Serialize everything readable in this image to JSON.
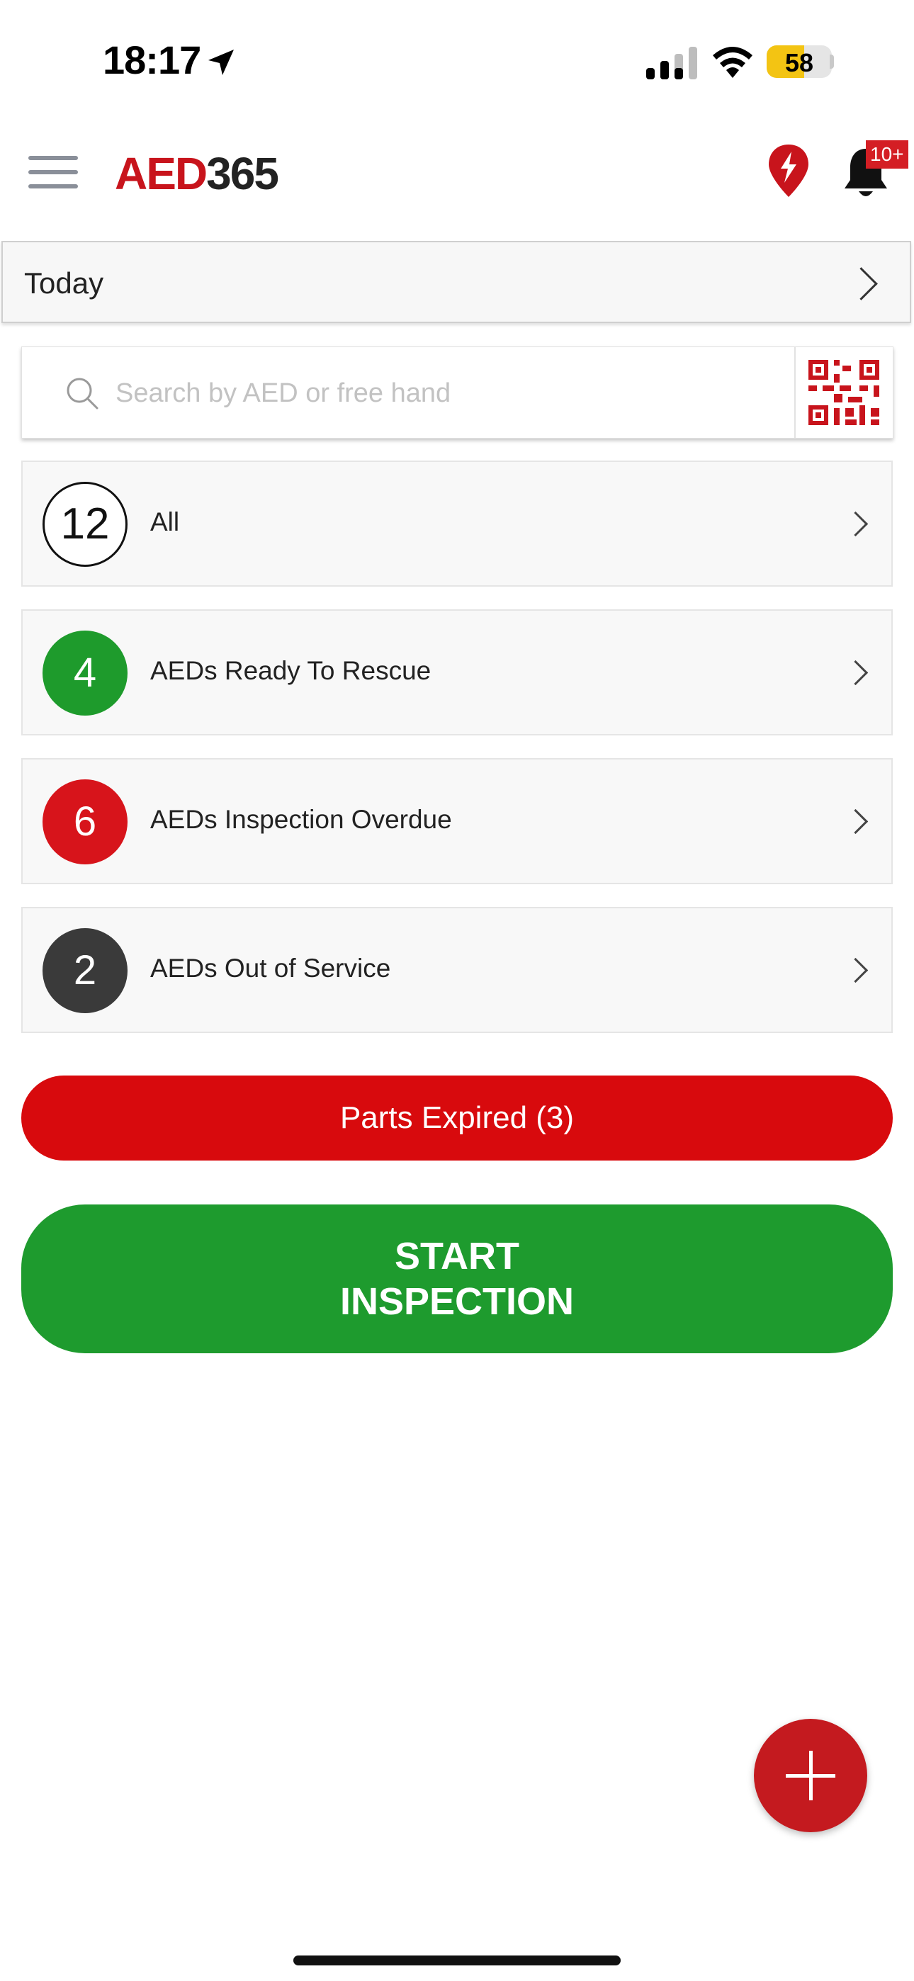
{
  "status_bar": {
    "time": "18:17",
    "battery_percent": "58",
    "battery_level": 0.58,
    "icons": [
      "location-arrow-icon",
      "cellular-signal-icon",
      "wifi-icon",
      "battery-icon"
    ]
  },
  "header": {
    "logo_part1": "AED",
    "logo_part2": "365",
    "notification_badge": "10+",
    "icons": [
      "menu-icon",
      "aed-location-pin-icon",
      "bell-icon"
    ]
  },
  "date_filter": {
    "label": "Today"
  },
  "search": {
    "placeholder": "Search by AED or free hand",
    "value": "",
    "icons": [
      "search-icon",
      "qr-code-icon"
    ]
  },
  "categories": [
    {
      "count": "12",
      "label": "All",
      "style": "outline"
    },
    {
      "count": "4",
      "label": "AEDs Ready To Rescue",
      "style": "green",
      "color": "#1e9b2c"
    },
    {
      "count": "6",
      "label": "AEDs Inspection Overdue",
      "style": "red",
      "color": "#d7141b"
    },
    {
      "count": "2",
      "label": "AEDs Out of Service",
      "style": "dark",
      "color": "#3a3a3a"
    }
  ],
  "parts_expired_label": "Parts Expired (3)",
  "start_inspection_label": "START INSPECTION",
  "fab_icon": "plus-icon",
  "colors": {
    "brand_red": "#c8141c",
    "parts_red": "#d80a0d",
    "start_green": "#1e9b2e",
    "battery_yellow": "#f3c413"
  }
}
